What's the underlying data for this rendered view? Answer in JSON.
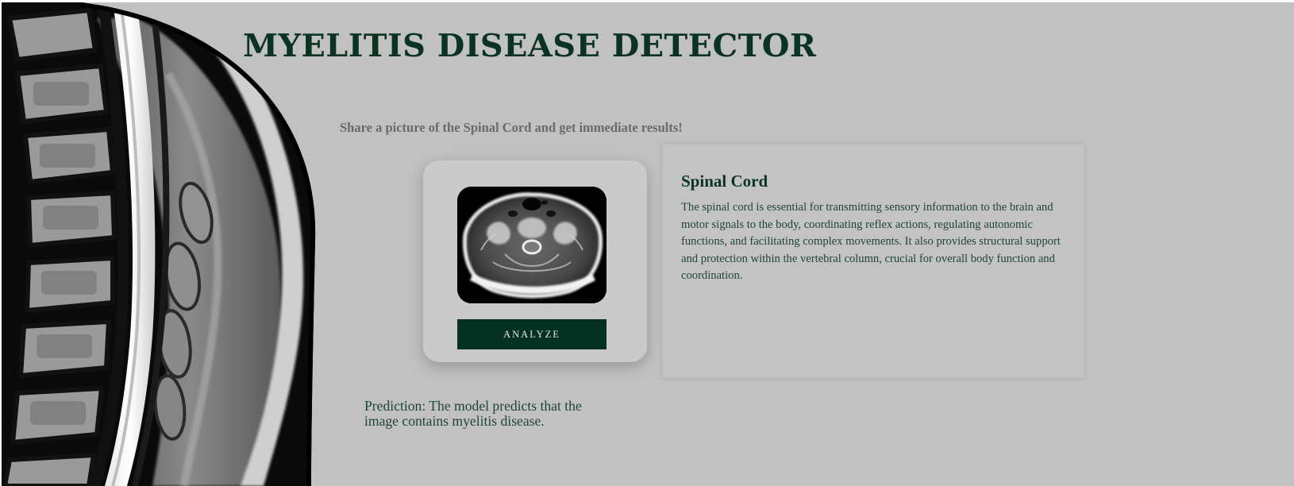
{
  "app": {
    "title": "MYELITIS DISEASE DETECTOR",
    "tagline": "Share a picture of the Spinal Cord and get immediate results!"
  },
  "upload": {
    "preview_image": "axial-spinal-mri-preview",
    "analyze_label": "ANALYZE"
  },
  "info": {
    "title": "Spinal Cord",
    "text": "The spinal cord is essential for transmitting sensory information to the brain and motor signals to the body, coordinating reflex actions, regulating autonomic functions, and facilitating complex movements. It also provides structural support and protection within the vertebral column, crucial for overall body function and coordination."
  },
  "prediction": {
    "text": "Prediction: The model predicts that the image contains myelitis disease."
  },
  "decor": {
    "side_image": "sagittal-spine-mri"
  },
  "colors": {
    "background": "#c1c1c1",
    "accent": "#053122",
    "title": "#0a3322",
    "body_text": "#1f4535",
    "tagline": "#6a6a6a"
  }
}
